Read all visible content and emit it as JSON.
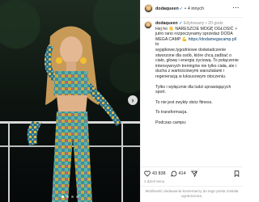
{
  "post": {
    "username": "dodaqueen",
    "verified_mark": "✔",
    "separator": "•",
    "collaborators": "4 innych",
    "more_icon": "more-horizontal-icon"
  },
  "caption": {
    "edited": "Edytowany",
    "time_ago": "20 godz.",
    "paragraphs": [
      "Hej ho 👋 NARESZCIE MOGĘ OGŁOSIĆ ⚡ jutro rano rozpoczynamy sprzedaż DODA MEGA CAMP 💪 https://dodamegacamp.pl/ to",
      "wyjątkowe,tygodniowe doświadczenie stworzone dla osób, które chcą zadbać o ciało, głowę i energię życiową. To połączenie intensywnych treningów nie tylko ciała, ale i ducha z wartościowymi warsztatami i regeneracją w luksusowym otoczeniu.",
      "Tylko i wyłącznie dla ludzi uprawiających sport.",
      "To nie jest zwykły obóz fitness.",
      "To transformacja.",
      "Podczas campu:"
    ]
  },
  "stats": {
    "likes": "43 838",
    "comments": "414"
  },
  "footer": {
    "date": "1 dzień temu",
    "comments_off": "Możliwość dodawania komentarzy do tego posta została ograniczona."
  },
  "media": {
    "slide_count": 4,
    "active_slide": 1,
    "next_icon": "chevron-right-icon"
  },
  "colors": {
    "link": "#00376b",
    "verified": "#3897f0",
    "muted": "#8e8e8e"
  }
}
